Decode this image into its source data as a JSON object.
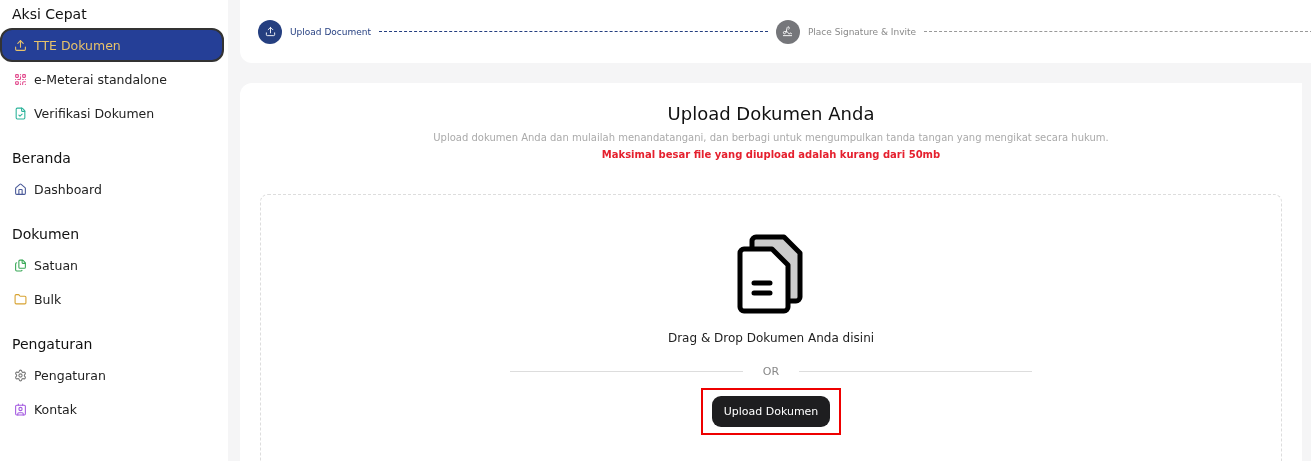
{
  "sidebar": {
    "sections": [
      {
        "title": "Aksi Cepat",
        "items": [
          {
            "label": "TTE Dokumen",
            "selected": true
          },
          {
            "label": "e-Meterai standalone",
            "selected": false
          },
          {
            "label": "Verifikasi Dokumen",
            "selected": false
          }
        ]
      },
      {
        "title": "Beranda",
        "items": [
          {
            "label": "Dashboard",
            "selected": false
          }
        ]
      },
      {
        "title": "Dokumen",
        "items": [
          {
            "label": "Satuan",
            "selected": false
          },
          {
            "label": "Bulk",
            "selected": false
          }
        ]
      },
      {
        "title": "Pengaturan",
        "items": [
          {
            "label": "Pengaturan",
            "selected": false
          },
          {
            "label": "Kontak",
            "selected": false
          }
        ]
      }
    ]
  },
  "stepper": [
    {
      "label": "Upload Document",
      "active": true
    },
    {
      "label": "Place Signature & Invite",
      "active": false
    }
  ],
  "upload": {
    "title": "Upload Dokumen Anda",
    "subtitle": "Upload dokumen Anda dan mulailah menandatangani, dan berbagi untuk mengumpulkan tanda tangan yang mengikat secara hukum.",
    "warning": "Maksimal besar file yang diupload adalah kurang dari 50mb",
    "drop_text": "Drag & Drop Dokumen Anda disini",
    "divider": "OR",
    "button": {
      "label": "Upload Dokumen",
      "highlighted": true
    }
  }
}
